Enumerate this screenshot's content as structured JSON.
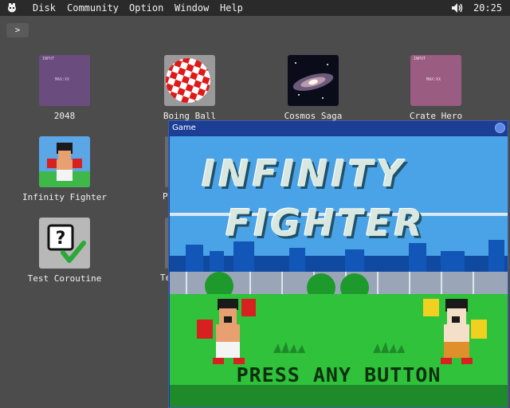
{
  "menubar": {
    "items": [
      "Disk",
      "Community",
      "Option",
      "Window",
      "Help"
    ],
    "clock": "20:25"
  },
  "desktop": {
    "expand_label": ">",
    "icons": [
      {
        "label": "2048",
        "icon": "2048-app-icon",
        "tiny_top": "INPUT",
        "tiny_mid": "MAX:XX"
      },
      {
        "label": "Boing Ball",
        "icon": "boing-ball-icon"
      },
      {
        "label": "Cosmos Saga",
        "icon": "galaxy-icon"
      },
      {
        "label": "Crate Hero",
        "icon": "crate-hero-icon",
        "tiny_top": "INPUT",
        "tiny_mid": "MAX:XX"
      },
      {
        "label": "Infinity Fighter",
        "icon": "fighter-icon"
      },
      {
        "label": "Test Coroutine",
        "icon": "question-check-icon"
      }
    ],
    "partial_labels": [
      "P",
      "Te"
    ]
  },
  "window": {
    "title": "Game",
    "game": {
      "logo_line1": "INFINITY",
      "logo_line2": "FIGHTER",
      "prompt": "PRESS ANY BUTTON"
    }
  },
  "colors": {
    "desktop_bg": "#4c4c4c",
    "menubar_bg": "#2a2a2a",
    "window_title": "#1c3f95",
    "grass": "#2fc23a",
    "sky": "#4aa3e6"
  }
}
